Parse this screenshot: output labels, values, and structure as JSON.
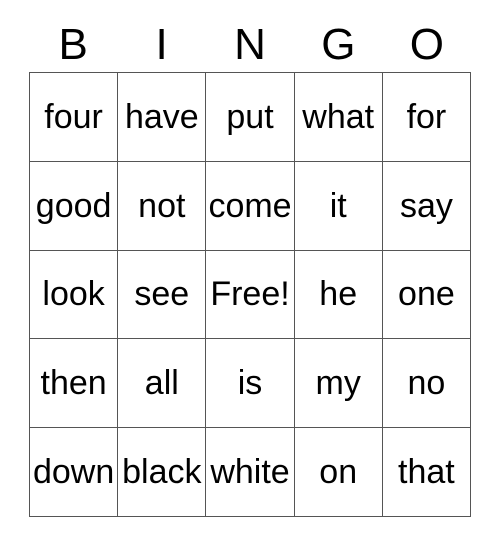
{
  "card": {
    "title": "BINGO",
    "header_letters": [
      "B",
      "I",
      "N",
      "G",
      "O"
    ],
    "free_space_label": "Free!",
    "free_space_position": {
      "row": 2,
      "col": 2
    },
    "grid_size": "5x5",
    "colors": {
      "background": "#ffffff",
      "cell_background": "#ffffff",
      "border": "#555555",
      "text": "#000000"
    },
    "rows": [
      [
        "four",
        "have",
        "put",
        "what",
        "for"
      ],
      [
        "good",
        "not",
        "come",
        "it",
        "say"
      ],
      [
        "look",
        "see",
        "Free!",
        "he",
        "one"
      ],
      [
        "then",
        "all",
        "is",
        "my",
        "no"
      ],
      [
        "down",
        "black",
        "white",
        "on",
        "that"
      ]
    ]
  }
}
